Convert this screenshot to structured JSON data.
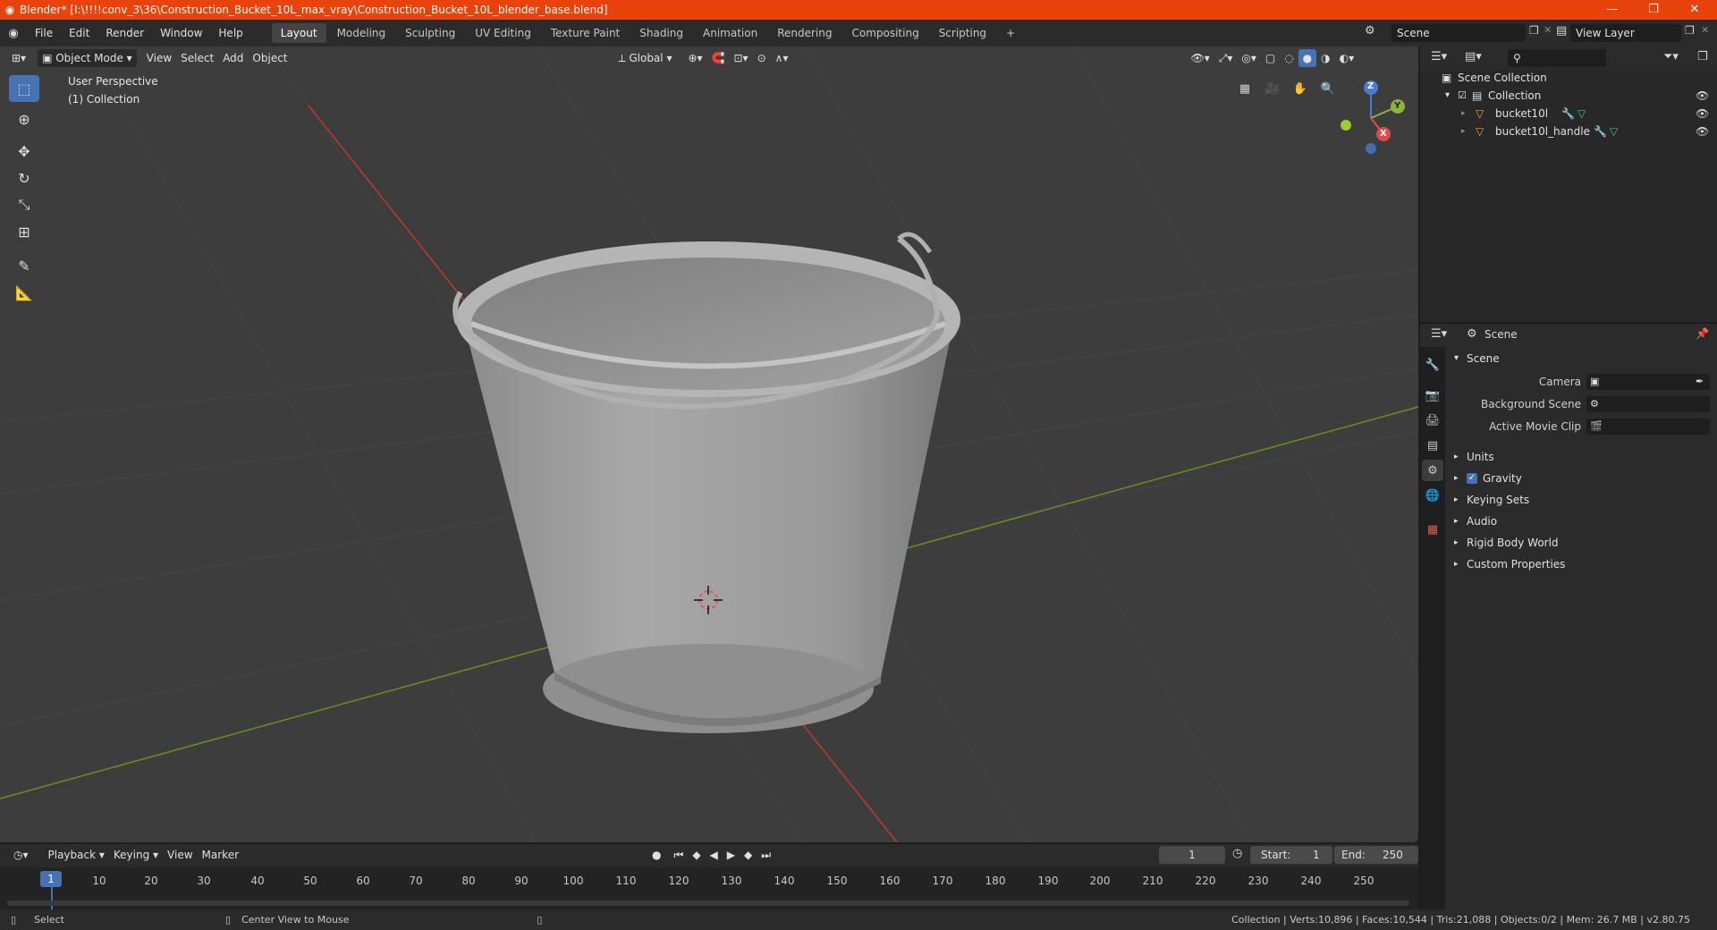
{
  "window": {
    "title": "Blender* [I:\\!!!!conv_3\\36\\Construction_Bucket_10L_max_vray\\Construction_Bucket_10L_blender_base.blend]",
    "minimize": "—",
    "maximize": "❐",
    "close": "✕"
  },
  "menu": {
    "items": [
      "File",
      "Edit",
      "Render",
      "Window",
      "Help"
    ]
  },
  "workspaces": {
    "tabs": [
      "Layout",
      "Modeling",
      "Sculpting",
      "UV Editing",
      "Texture Paint",
      "Shading",
      "Animation",
      "Rendering",
      "Compositing",
      "Scripting"
    ],
    "active": "Layout",
    "add": "+"
  },
  "scene_selector": {
    "value": "Scene"
  },
  "view_layer_selector": {
    "value": "View Layer"
  },
  "viewport": {
    "mode": "Object Mode",
    "menus": [
      "View",
      "Select",
      "Add",
      "Object"
    ],
    "transform_orientation": "Global",
    "overlay_text_1": "User Perspective",
    "overlay_text_2": "(1) Collection",
    "gizmo": {
      "x": "X",
      "y": "Y",
      "z": "Z"
    }
  },
  "outliner": {
    "search_placeholder": "",
    "root": "Scene Collection",
    "collection": "Collection",
    "objects": [
      "bucket10l",
      "bucket10l_handle"
    ]
  },
  "properties": {
    "header_title": "Scene",
    "panel_title": "Scene",
    "camera_label": "Camera",
    "background_scene_label": "Background Scene",
    "active_movie_clip_label": "Active Movie Clip",
    "sections": [
      "Units",
      "Gravity",
      "Keying Sets",
      "Audio",
      "Rigid Body World",
      "Custom Properties"
    ],
    "gravity_checked": true
  },
  "timeline": {
    "menus": [
      "Playback",
      "Keying",
      "View",
      "Marker"
    ],
    "current_frame": "1",
    "start_label": "Start:",
    "start_value": "1",
    "end_label": "End:",
    "end_value": "250",
    "ruler": [
      "10",
      "20",
      "30",
      "40",
      "50",
      "60",
      "70",
      "80",
      "90",
      "100",
      "110",
      "120",
      "130",
      "140",
      "150",
      "160",
      "170",
      "180",
      "190",
      "200",
      "210",
      "220",
      "230",
      "240",
      "250"
    ],
    "playhead": "1"
  },
  "status": {
    "left_action": "Select",
    "middle_action": "Center View to Mouse",
    "stats": "Collection | Verts:10,896 | Faces:10,544 | Tris:21,088 | Objects:0/2 | Mem: 26.7 MB | v2.80.75"
  },
  "colors": {
    "titlebar": "#e8420d",
    "accent": "#4772b3",
    "viewport_bg": "#3d3d3d",
    "x_axis": "#c0392b",
    "y_axis": "#6b8e23"
  }
}
